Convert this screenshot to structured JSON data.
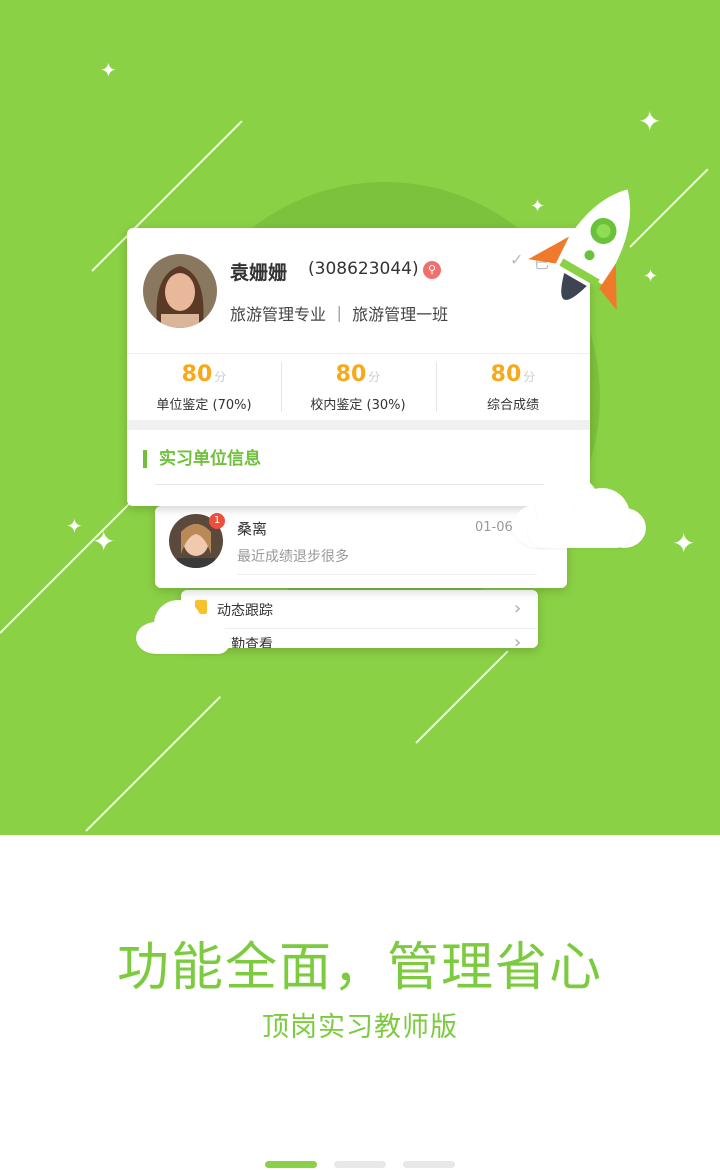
{
  "profile": {
    "name": "袁姗姗",
    "id_text": "(308623044)",
    "pin_glyph": "⚲",
    "major": "旅游管理专业 ｜ 旅游管理一班",
    "check_glyph": "✓",
    "check_char": "已"
  },
  "stats": [
    {
      "value": "80",
      "unit": "分",
      "label": "单位鉴定 (70%)"
    },
    {
      "value": "80",
      "unit": "分",
      "label": "校内鉴定 (30%)"
    },
    {
      "value": "80",
      "unit": "分",
      "label": "综合成绩"
    }
  ],
  "section": {
    "title": "实习单位信息"
  },
  "message": {
    "sender": "桑离",
    "date": "01-06",
    "preview": "最近成绩退步很多",
    "badge_count": "1"
  },
  "menu": [
    {
      "label": "动态跟踪",
      "chevron": "›"
    },
    {
      "label": "考勤查看",
      "chevron": "›"
    }
  ],
  "headline": "功能全面，管理省心",
  "subline": "顶岗实习教师版",
  "pager": {
    "count": 3,
    "active_index": 0
  },
  "colors": {
    "brand_green": "#8bd145",
    "accent_orange": "#f8a919",
    "badge_red": "#f04e3d",
    "text_green": "#7ccb3e"
  },
  "icons": {
    "star": "sparkle-icon",
    "rocket": "rocket-icon",
    "cloud": "cloud-icon",
    "chevron": "chevron-right-icon"
  }
}
